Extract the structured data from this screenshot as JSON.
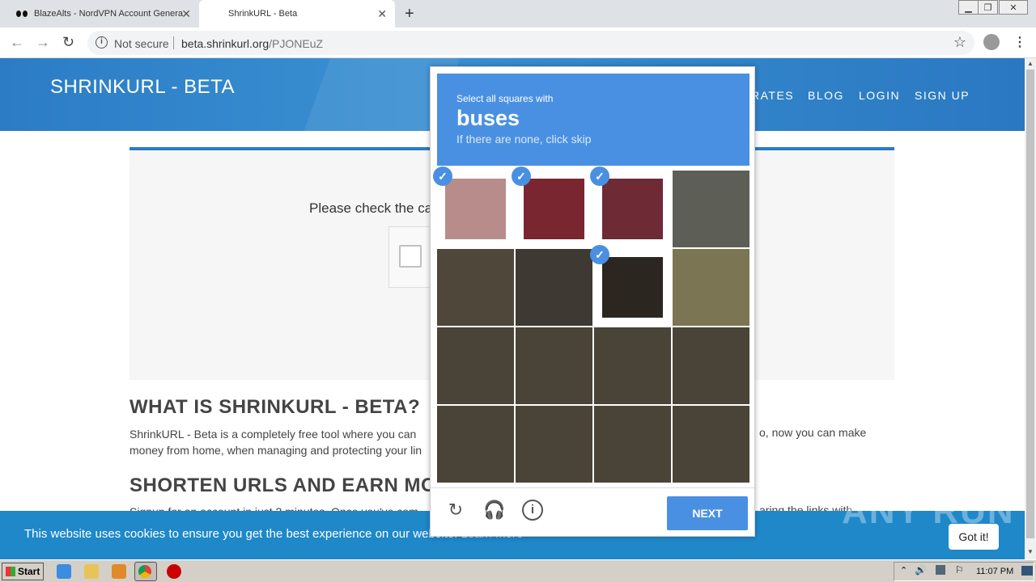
{
  "browser": {
    "tabs": [
      {
        "title": "BlazeAlts - NordVPN Account Genera"
      },
      {
        "title": "ShrinkURL - Beta"
      }
    ],
    "address": {
      "security": "Not secure",
      "host": "beta.shrinkurl.org",
      "path": "/PJONEuZ"
    }
  },
  "site": {
    "brand": "SHRINKURL - BETA",
    "nav": [
      "RATES",
      "BLOG",
      "LOGIN",
      "SIGN UP"
    ],
    "check_text": "Please check the ca",
    "h_what": "WHAT IS SHRINKURL - BETA?",
    "para1_a": "ShrinkURL - Beta is a completely free tool where you can",
    "para1_b": "money from home, when managing and protecting your lin",
    "para1_right": "o, now you can make",
    "h_shorten": "SHORTEN URLS AND EARN MO",
    "para2": "Signup for an account in just 2 minutes. Once you've com",
    "para2_right": "aring the links with"
  },
  "cookie_bar": {
    "text": "This website uses cookies to ensure you get the best experience on our website.",
    "link": "Learn more",
    "button": "Got it!"
  },
  "captcha": {
    "instruction": "Select all squares with",
    "target": "buses",
    "hint": "If there are none, click skip",
    "next_label": "NEXT",
    "selected_cells": [
      0,
      1,
      2,
      6
    ],
    "icons": [
      "reload-icon",
      "audio-icon",
      "info-icon"
    ]
  },
  "watermark": "ANY RUN",
  "taskbar": {
    "start": "Start",
    "clock": "11:07 PM"
  }
}
